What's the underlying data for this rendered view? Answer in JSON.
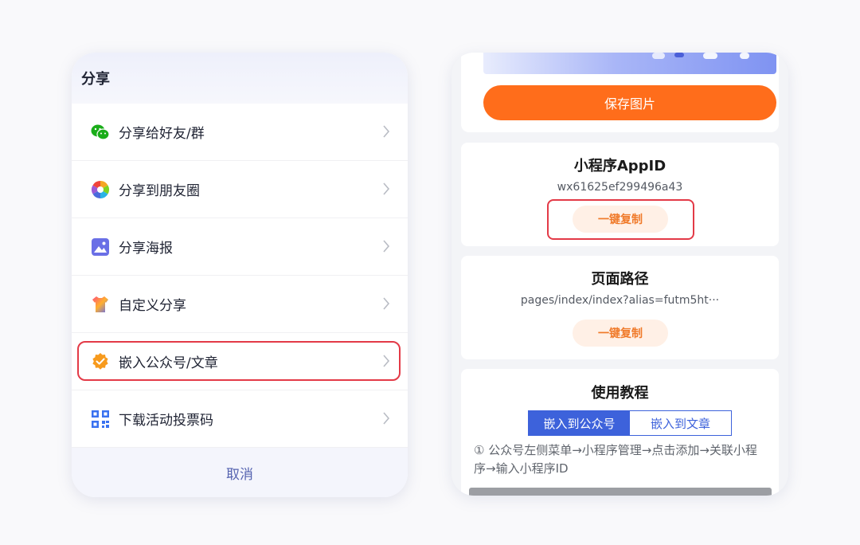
{
  "share_sheet": {
    "title": "分享",
    "items": [
      {
        "label": "分享给好友/群",
        "icon": "wechat-icon"
      },
      {
        "label": "分享到朋友圈",
        "icon": "moments-icon"
      },
      {
        "label": "分享海报",
        "icon": "poster-image-icon"
      },
      {
        "label": "自定义分享",
        "icon": "custom-share-icon"
      },
      {
        "label": "嵌入公众号/文章",
        "icon": "verified-badge-icon"
      },
      {
        "label": "下载活动投票码",
        "icon": "qr-code-icon"
      }
    ],
    "cancel_label": "取消"
  },
  "embed_panel": {
    "save_image_label": "保存图片",
    "appid_card": {
      "title": "小程序AppID",
      "value": "wx61625ef299496a43",
      "copy_label": "一键复制"
    },
    "path_card": {
      "title": "页面路径",
      "value": "pages/index/index?alias=futm5ht···",
      "copy_label": "一键复制"
    },
    "tutorial_card": {
      "title": "使用教程",
      "tabs": [
        "嵌入到公众号",
        "嵌入到文章"
      ],
      "active_tab": 0,
      "step_text": "① 公众号左侧菜单→小程序管理→点击添加→关联小程序→输入小程序ID"
    }
  },
  "colors": {
    "accent_orange": "#ff6d1b",
    "copy_btn_text": "#f07a2a",
    "tab_blue": "#3d62db",
    "highlight_red": "#e33a47",
    "cancel_text": "#5563b0"
  }
}
